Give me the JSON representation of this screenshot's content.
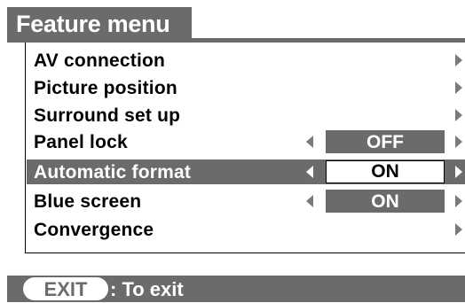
{
  "menu": {
    "title": "Feature menu",
    "items": [
      {
        "label": "AV connection",
        "value": "",
        "selected": false
      },
      {
        "label": "Picture position",
        "value": "",
        "selected": false
      },
      {
        "label": "Surround set up",
        "value": "",
        "selected": false
      },
      {
        "label": "Panel lock",
        "value": "OFF",
        "selected": false
      },
      {
        "label": "Automatic format",
        "value": "ON",
        "selected": true
      },
      {
        "label": "Blue screen",
        "value": "ON",
        "selected": false
      },
      {
        "label": "Convergence",
        "value": "",
        "selected": false
      }
    ]
  },
  "footer": {
    "exit_key": "EXIT",
    "exit_text": ": To exit"
  },
  "icons": {
    "right_arrow": "triangle-right-icon",
    "left_arrow": "triangle-left-icon"
  },
  "colors": {
    "panel_gray": "#6b6b6b",
    "arrow_gray": "#7a7a7a",
    "selected_value_bg": "#ffffff"
  }
}
